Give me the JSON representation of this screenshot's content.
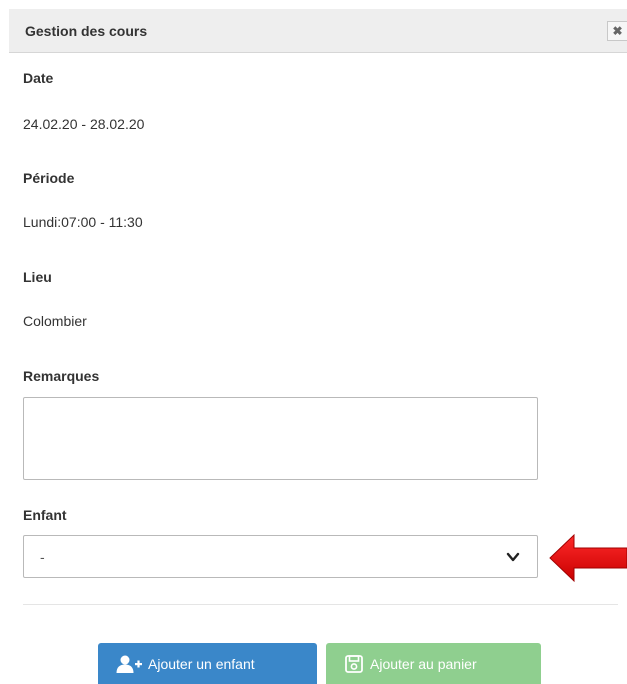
{
  "dialog": {
    "title": "Gestion des cours",
    "close_label": "✖"
  },
  "fields": {
    "date_label": "Date",
    "date_value": "24.02.20 - 28.02.20",
    "periode_label": "Période",
    "periode_value": "Lundi:07:00 - 11:30",
    "lieu_label": "Lieu",
    "lieu_value": "Colombier",
    "remarques_label": "Remarques",
    "remarques_value": "",
    "enfant_label": "Enfant",
    "enfant_selected": "-"
  },
  "icons": {
    "close": "close-icon",
    "chevron": "chevron-down-icon",
    "add_user": "add-user-icon",
    "save": "save-icon",
    "pointer": "red-arrow-icon"
  },
  "buttons": {
    "add_child_label": "Ajouter un enfant",
    "add_cart_label": "Ajouter au panier"
  },
  "colors": {
    "primary": "#3a87c9",
    "success": "#8fcf8f",
    "arrow": "#e00000"
  }
}
